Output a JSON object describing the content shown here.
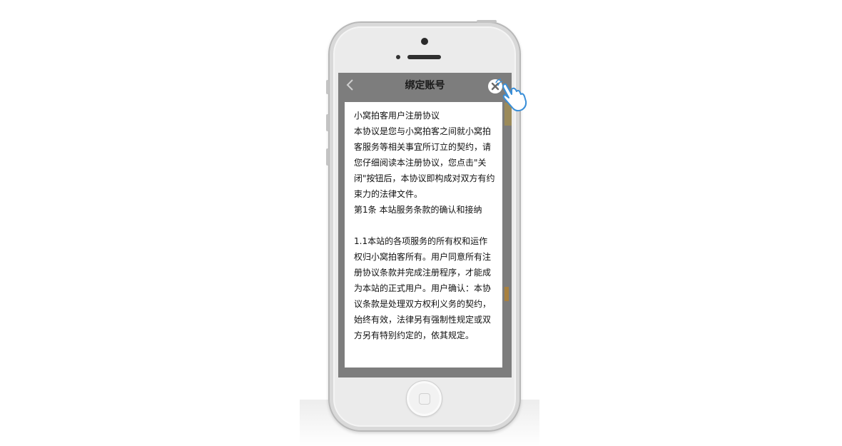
{
  "app": {
    "title": "绑定账号"
  },
  "icons": {
    "back": "chevron-left-icon",
    "close": "close-circle-icon",
    "pointer": "hand-pointer-icon"
  },
  "agreement": {
    "heading": "小窝拍客用户注册协议",
    "lines": [
      "本协议是您与小窝拍客之间就小窝拍客服务等相关事宜所订立的契约，请您仔细阅读本注册协议，您点击\"关闭\"按钮后，本协议即构成对双方有约束力的法律文件。",
      "第1条 本站服务条款的确认和接纳",
      "1.1本站的各项服务的所有权和运作权归小窝拍客所有。用户同意所有注册协议条款并完成注册程序，才能成为本站的正式用户。用户确认：本协议条款是处理双方权利义务的契约，始终有效，法律另有强制性规定或双方另有特别约定的，依其规定。"
    ]
  },
  "colors": {
    "overlay": "#7d7d7d",
    "accent_blue": "#3a8fd8"
  }
}
